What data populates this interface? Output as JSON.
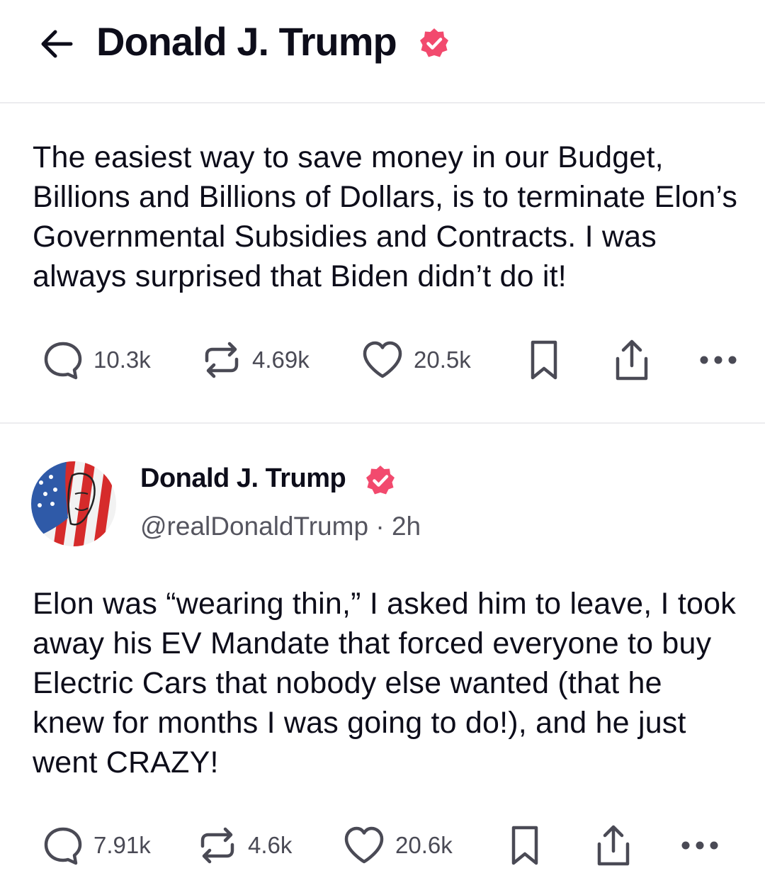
{
  "header": {
    "back_icon": "arrow-left-icon",
    "title": "Donald J. Trump",
    "verified_icon": "verified-badge-icon"
  },
  "colors": {
    "verified": "#f24a6e",
    "text": "#0d0d1a",
    "muted": "#4a4a55",
    "divider": "#ececef"
  },
  "posts": [
    {
      "text": "The easiest way to save money in our Budget, Billions and Billions of Dollars, is to terminate Elon’s Governmental Subsidies and Contracts. I was always surprised that Biden didn’t do it!",
      "replies": "10.3k",
      "reposts": "4.69k",
      "likes": "20.5k"
    },
    {
      "author": {
        "name": "Donald J. Trump",
        "handle": "@realDonaldTrump",
        "time": "2h",
        "separator": "·"
      },
      "text": "Elon was “wearing thin,” I asked him to leave, I took away his EV Mandate that forced everyone to buy Electric Cars that nobody else wanted (that he knew for months I was going to do!), and he just went CRAZY!",
      "replies": "7.91k",
      "reposts": "4.6k",
      "likes": "20.6k"
    }
  ],
  "action_icons": [
    "reply-icon",
    "repost-icon",
    "like-icon",
    "bookmark-icon",
    "share-icon",
    "more-icon"
  ]
}
